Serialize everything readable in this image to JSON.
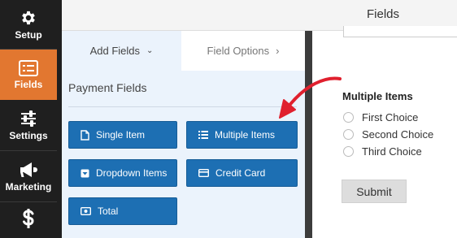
{
  "sidebar": {
    "items": [
      {
        "label": "Setup",
        "icon": "gear-icon"
      },
      {
        "label": "Fields",
        "icon": "fields-list-icon",
        "active": true
      },
      {
        "label": "Settings",
        "icon": "sliders-icon"
      },
      {
        "label": "Marketing",
        "icon": "megaphone-icon"
      },
      {
        "label": "",
        "icon": "dollar-icon"
      }
    ]
  },
  "header": {
    "title": "Fields"
  },
  "tabs": {
    "add_fields": "Add Fields",
    "field_options": "Field Options"
  },
  "panel": {
    "section_title": "Payment Fields",
    "buttons": [
      {
        "label": "Single Item",
        "icon": "file-icon"
      },
      {
        "label": "Multiple Items",
        "icon": "list-icon"
      },
      {
        "label": "Dropdown Items",
        "icon": "dropdown-icon"
      },
      {
        "label": "Credit Card",
        "icon": "credit-card-icon"
      },
      {
        "label": "Total",
        "icon": "money-icon"
      }
    ]
  },
  "preview": {
    "question_label": "Multiple Items",
    "choices": [
      "First Choice",
      "Second Choice",
      "Third Choice"
    ],
    "submit_label": "Submit"
  },
  "colors": {
    "accent": "#e27730",
    "button_blue": "#1d6fb3",
    "annotation_red": "#e0202e",
    "sidebar_bg": "#1f1f1f"
  }
}
